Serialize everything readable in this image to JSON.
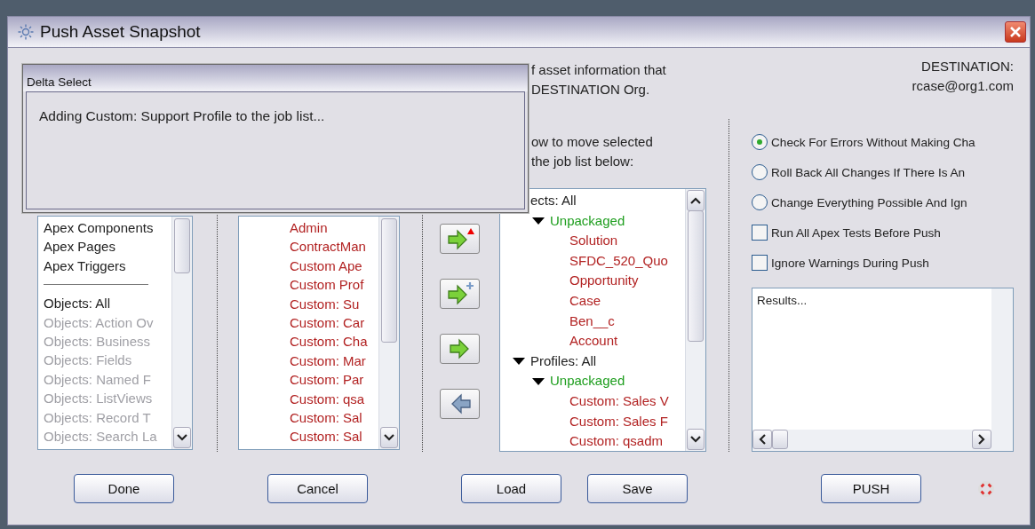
{
  "window": {
    "title": "Push Asset Snapshot"
  },
  "overlay": {
    "title": "Delta Select",
    "message": "Adding Custom: Support Profile to the job list..."
  },
  "description": [
    "f asset information that",
    "DESTINATION Org."
  ],
  "instruction": [
    "ow to move selected",
    "the job list below:"
  ],
  "destination": [
    "DESTINATION:",
    "rcase@org1.com"
  ],
  "asset_types": [
    {
      "kind": "item",
      "label": "Apex Components",
      "disabled": false
    },
    {
      "kind": "item",
      "label": "Apex Pages",
      "disabled": false
    },
    {
      "kind": "item",
      "label": "Apex Triggers",
      "disabled": false
    },
    {
      "kind": "separator"
    },
    {
      "kind": "item",
      "label": "Objects: All",
      "disabled": false
    },
    {
      "kind": "item",
      "label": "Objects: Action Ov",
      "disabled": true
    },
    {
      "kind": "item",
      "label": "Objects: Business",
      "disabled": true
    },
    {
      "kind": "item",
      "label": "Objects: Fields",
      "disabled": true
    },
    {
      "kind": "item",
      "label": "Objects: Named F",
      "disabled": true
    },
    {
      "kind": "item",
      "label": "Objects: ListViews",
      "disabled": true
    },
    {
      "kind": "item",
      "label": "Objects: Record T",
      "disabled": true
    },
    {
      "kind": "item",
      "label": "Objects: Search La",
      "disabled": true
    }
  ],
  "assets": [
    "Admin",
    "ContractMan",
    "Custom Ape",
    "Custom Prof",
    "Custom:  Su",
    "Custom: Car",
    "Custom: Cha",
    "Custom: Mar",
    "Custom: Par",
    "Custom: qsa",
    "Custom: Sal",
    "Custom: Sal"
  ],
  "move_buttons": [
    {
      "kind": "add-changed"
    },
    {
      "kind": "add-new"
    },
    {
      "kind": "add"
    },
    {
      "kind": "remove"
    }
  ],
  "job_list": [
    {
      "label": "ects: All",
      "kind": "category",
      "expanded": true,
      "children": [
        {
          "label": "Unpackaged",
          "kind": "package",
          "expanded": true,
          "children": [
            {
              "label": "Solution",
              "kind": "component"
            },
            {
              "label": "SFDC_520_Quo",
              "kind": "component"
            },
            {
              "label": "Opportunity",
              "kind": "component"
            },
            {
              "label": "Case",
              "kind": "component"
            },
            {
              "label": "Ben__c",
              "kind": "component"
            },
            {
              "label": "Account",
              "kind": "component"
            }
          ]
        }
      ]
    },
    {
      "label": "Profiles: All",
      "kind": "category",
      "expanded": true,
      "children": [
        {
          "label": "Unpackaged",
          "kind": "package",
          "expanded": true,
          "children": [
            {
              "label": "Custom: Sales V",
              "kind": "component"
            },
            {
              "label": "Custom: Sales F",
              "kind": "component"
            },
            {
              "label": "Custom: qsadm",
              "kind": "component"
            }
          ]
        }
      ]
    }
  ],
  "options": [
    {
      "kind": "radio",
      "label": "Check For Errors Without Making Cha",
      "selected": true
    },
    {
      "kind": "radio",
      "label": "Roll Back All Changes If There Is An",
      "selected": false
    },
    {
      "kind": "radio",
      "label": "Change Everything Possible And Ign",
      "selected": false
    },
    {
      "kind": "checkbox",
      "label": "Run All Apex Tests Before Push",
      "checked": false
    },
    {
      "kind": "checkbox",
      "label": "Ignore Warnings During Push",
      "checked": false
    }
  ],
  "results": {
    "value": "Results..."
  },
  "buttons": {
    "done": "Done",
    "cancel": "Cancel",
    "load": "Load",
    "save": "Save",
    "push": "PUSH"
  }
}
